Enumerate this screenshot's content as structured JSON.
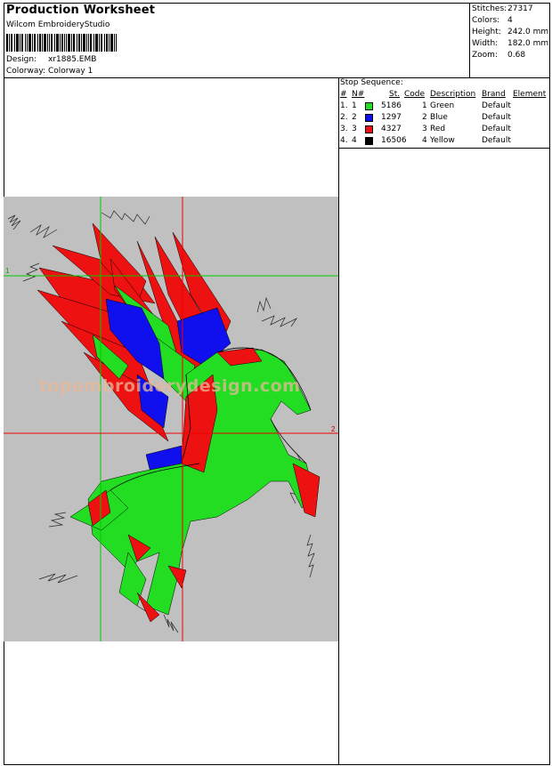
{
  "header": {
    "title": "Production Worksheet",
    "software": "Wilcom EmbroideryStudio",
    "design_label": "Design:",
    "design_value": "xr1885.EMB",
    "colorway_label": "Colorway:",
    "colorway_value": "Colorway 1"
  },
  "stats": [
    {
      "label": "Stitches:",
      "value": "27317"
    },
    {
      "label": "Colors:",
      "value": "4"
    },
    {
      "label": "Height:",
      "value": "242.0 mm"
    },
    {
      "label": "Width:",
      "value": "182.0 mm"
    },
    {
      "label": "Zoom:",
      "value": "0.68"
    }
  ],
  "sequence": {
    "title": "Stop Sequence:",
    "headers": {
      "num": "#",
      "n": "N#",
      "st": "St.",
      "code": "Code",
      "description": "Description",
      "brand": "Brand",
      "element": "Element"
    },
    "rows": [
      {
        "num": "1.",
        "n": "1",
        "color": "#22dd22",
        "st": "5186",
        "code": "1",
        "description": "Green",
        "brand": "Default"
      },
      {
        "num": "2.",
        "n": "2",
        "color": "#1010ee",
        "st": "1297",
        "code": "2",
        "description": "Blue",
        "brand": "Default"
      },
      {
        "num": "3.",
        "n": "3",
        "color": "#ee1111",
        "st": "4327",
        "code": "3",
        "description": "Red",
        "brand": "Default"
      },
      {
        "num": "4.",
        "n": "4",
        "color": "#000000",
        "st": "16506",
        "code": "4",
        "description": "Yellow",
        "brand": "Default"
      }
    ]
  },
  "preview": {
    "background": "#c0c0c0",
    "guide_v_green_label": "",
    "marker_1": "1",
    "marker_2": "2",
    "watermark": "topembroiderydesign.com"
  }
}
